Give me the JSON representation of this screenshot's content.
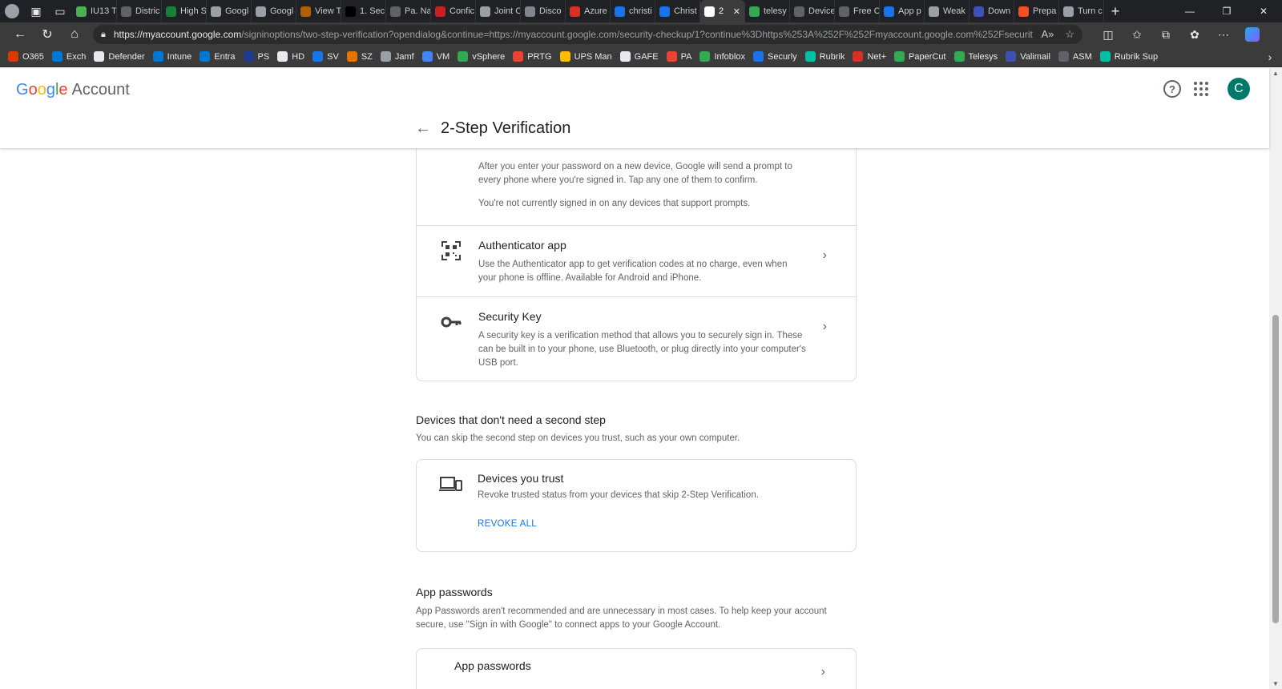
{
  "browser": {
    "tabs": [
      {
        "label": "IU13 T",
        "color": "#4caf50"
      },
      {
        "label": "Distric",
        "color": "#5f6368"
      },
      {
        "label": "High S",
        "color": "#188038"
      },
      {
        "label": "Googl",
        "color": "#9aa0a6"
      },
      {
        "label": "Googl",
        "color": "#9aa0a6"
      },
      {
        "label": "View T",
        "color": "#b06000"
      },
      {
        "label": "1. Sec",
        "color": "#000000"
      },
      {
        "label": "Pa. Na",
        "color": "#5f6368"
      },
      {
        "label": "Confic",
        "color": "#c5221f"
      },
      {
        "label": "Joint C",
        "color": "#9aa0a6"
      },
      {
        "label": "Disco",
        "color": "#80868b"
      },
      {
        "label": "Azure",
        "color": "#d93025"
      },
      {
        "label": "christi",
        "color": "#1a73e8"
      },
      {
        "label": "Christ",
        "color": "#1a73e8"
      },
      {
        "label": "2",
        "color": "#ffffff",
        "active": true,
        "close": "✕"
      },
      {
        "label": "telesy",
        "color": "#34a853"
      },
      {
        "label": "Device",
        "color": "#5f6368"
      },
      {
        "label": "Free C",
        "color": "#5f6368"
      },
      {
        "label": "App p",
        "color": "#1a73e8"
      },
      {
        "label": "Weak",
        "color": "#9aa0a6"
      },
      {
        "label": "Down",
        "color": "#3f51b5"
      },
      {
        "label": "Prepa",
        "color": "#f25022"
      },
      {
        "label": "Turn c",
        "color": "#9aa0a6"
      }
    ],
    "new_tab": "+",
    "window_controls": {
      "minimize": "—",
      "restore": "❐",
      "close": "✕"
    },
    "url_host": "https://myaccount.google.com",
    "url_path": "/signinoptions/two-step-verification?opendialog&continue=https://myaccount.google.com/security-checkup/1?continue%3Dhttps%253A%252F%252Fmyaccount.google.com%252Fsecurity...",
    "bookmarks": [
      {
        "label": "O365",
        "color": "#d83b01"
      },
      {
        "label": "Exch",
        "color": "#0078d4"
      },
      {
        "label": "Defender",
        "color": "#e8eaed"
      },
      {
        "label": "Intune",
        "color": "#0078d4"
      },
      {
        "label": "Entra",
        "color": "#0078d4"
      },
      {
        "label": "PS",
        "color": "#1e3a8a"
      },
      {
        "label": "HD",
        "color": "#e8eaed"
      },
      {
        "label": "SV",
        "color": "#1a73e8"
      },
      {
        "label": "SZ",
        "color": "#e37400"
      },
      {
        "label": "Jamf",
        "color": "#9aa0a6"
      },
      {
        "label": "VM",
        "color": "#4285f4"
      },
      {
        "label": "vSphere",
        "color": "#34a853"
      },
      {
        "label": "PRTG",
        "color": "#ea4335"
      },
      {
        "label": "UPS Man",
        "color": "#fbbc05"
      },
      {
        "label": "GAFE",
        "color": "#e8eaed"
      },
      {
        "label": "PA",
        "color": "#ea4335"
      },
      {
        "label": "Infoblox",
        "color": "#34a853"
      },
      {
        "label": "Securly",
        "color": "#1a73e8"
      },
      {
        "label": "Rubrik",
        "color": "#00bfa5"
      },
      {
        "label": "Net+",
        "color": "#d93025"
      },
      {
        "label": "PaperCut",
        "color": "#34a853"
      },
      {
        "label": "Telesys",
        "color": "#34a853"
      },
      {
        "label": "Valimail",
        "color": "#3f51b5"
      },
      {
        "label": "ASM",
        "color": "#5f6368"
      },
      {
        "label": "Rubrik Sup",
        "color": "#00bfa5"
      }
    ],
    "bookmarks_more": "›"
  },
  "header": {
    "logo_letters": [
      "G",
      "o",
      "o",
      "g",
      "l",
      "e"
    ],
    "logo_suffix": "Account",
    "help": "?",
    "avatar_letter": "C",
    "back": "←",
    "title": "2-Step Verification"
  },
  "card1": {
    "prompt_desc_1": "After you enter your password on a new device, Google will send a prompt to every phone where you're signed in. Tap any one of them to confirm.",
    "prompt_desc_2": "You're not currently signed in on any devices that support prompts.",
    "authenticator": {
      "title": "Authenticator app",
      "desc": "Use the Authenticator app to get verification codes at no charge, even when your phone is offline. Available for Android and iPhone.",
      "chevron": "›"
    },
    "security_key": {
      "title": "Security Key",
      "desc": "A security key is a verification method that allows you to securely sign in. These can be built in to your phone, use Bluetooth, or plug directly into your computer's USB port.",
      "chevron": "›"
    }
  },
  "devices_section": {
    "title": "Devices that don't need a second step",
    "desc": "You can skip the second step on devices you trust, such as your own computer.",
    "card_title": "Devices you trust",
    "card_desc": "Revoke trusted status from your devices that skip 2-Step Verification.",
    "revoke_label": "REVOKE ALL"
  },
  "app_passwords": {
    "title": "App passwords",
    "desc": "App Passwords aren't recommended and are unnecessary in most cases. To help keep your account secure, use \"Sign in with Google\" to connect apps to your Google Account.",
    "card_title": "App passwords",
    "chevron": "›"
  }
}
